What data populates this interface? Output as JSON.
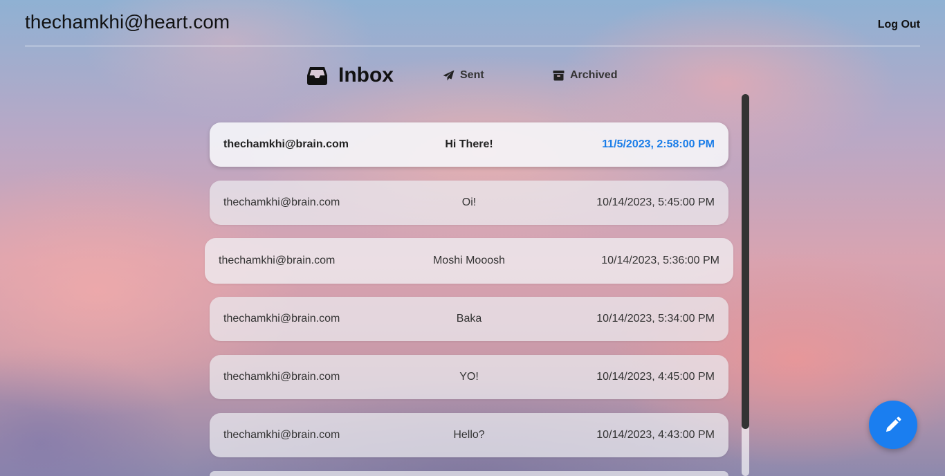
{
  "header": {
    "user_email": "thechamkhi@heart.com",
    "logout_label": "Log Out"
  },
  "tabs": [
    {
      "label": "Inbox",
      "icon": "inbox-icon",
      "active": true
    },
    {
      "label": "Sent",
      "icon": "paper-plane-icon",
      "active": false
    },
    {
      "label": "Archived",
      "icon": "archive-box-icon",
      "active": false
    }
  ],
  "messages": [
    {
      "from": "thechamkhi@brain.com",
      "subject": "Hi There!",
      "date": "11/5/2023, 2:58:00 PM",
      "unread": true
    },
    {
      "from": "thechamkhi@brain.com",
      "subject": "Oi!",
      "date": "10/14/2023, 5:45:00 PM",
      "unread": false
    },
    {
      "from": "thechamkhi@brain.com",
      "subject": "Moshi Mooosh",
      "date": "10/14/2023, 5:36:00 PM",
      "unread": false
    },
    {
      "from": "thechamkhi@brain.com",
      "subject": "Baka",
      "date": "10/14/2023, 5:34:00 PM",
      "unread": false
    },
    {
      "from": "thechamkhi@brain.com",
      "subject": "YO!",
      "date": "10/14/2023, 4:45:00 PM",
      "unread": false
    },
    {
      "from": "thechamkhi@brain.com",
      "subject": "Hello?",
      "date": "10/14/2023, 4:43:00 PM",
      "unread": false
    }
  ],
  "compose": {
    "icon": "pencil-icon"
  },
  "colors": {
    "accent": "#1a7ef0",
    "unread_date": "#1a7de8"
  }
}
